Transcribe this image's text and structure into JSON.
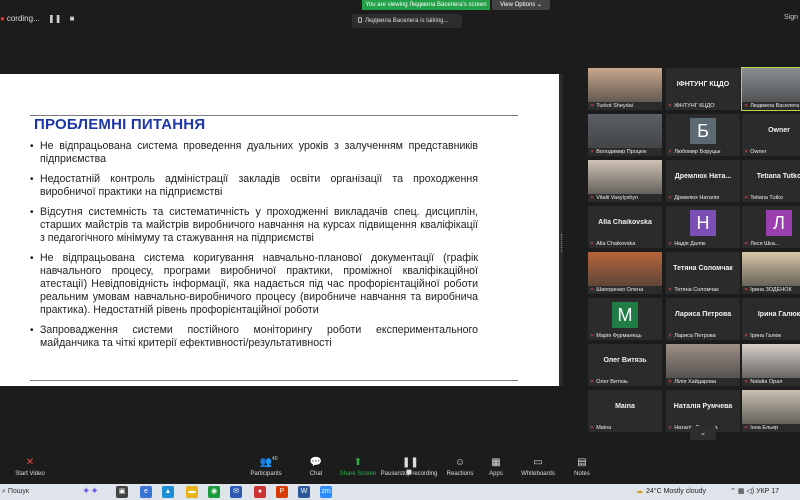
{
  "topbar": {
    "recording": "cording...",
    "recording_dot": "9",
    "viewing_banner": "You are viewing Людмила Васелега's screen",
    "view_options": "View Options",
    "talking": "Людмила Васелега is talking...",
    "sign_in": "Sign"
  },
  "slide": {
    "title": "ПРОБЛЕМНІ ПИТАННЯ",
    "bullets": [
      "Не відпрацьована система проведення дуальних уроків з залученням представників підприємства",
      "Недостатній контроль адміністрації закладів освіти організації та проходження виробничої практики на підприємстві",
      "Відсутня системність та систематичність у проходженні викладачів спец. дисциплін, старших майстрів та майстрів виробничого навчання на курсах підвищення кваліфікації з педагогічного мінімуму та стажування на підприємстві",
      "Не відпрацьована система коригування навчально-планової документації (графік навчального процесу, програми виробничої практики, проміжної кваліфікаційної атестації) Невідповідність інформації, яка надається під час профорієнтаційної роботи реальним умовам навчально-виробничого процесу (виробниче навчання та виробнича практика). Недостатній рівень профорієнтаційної роботи",
      "Запровадження системи постійного моніторингу роботи експериментального майданчика та чіткі критерії ефективності/результативності"
    ]
  },
  "gallery": {
    "tiles": [
      {
        "name": "Turkot Sheydai",
        "big": "",
        "letter": "",
        "color": "#c8a78d"
      },
      {
        "name": "ІФНТУНГ КЦДО",
        "big": "ІФНТУНГ КЦДО",
        "letter": "",
        "color": ""
      },
      {
        "name": "Людмила Васелега",
        "big": "",
        "letter": "",
        "color": "#8a8f93"
      },
      {
        "name": "Володимир Процюк",
        "big": "",
        "letter": "",
        "color": "#5a6066"
      },
      {
        "name": "Любомир Боруцьк",
        "big": "",
        "letter": "Б",
        "color": "#5b6a73"
      },
      {
        "name": "Owner",
        "big": "Owner",
        "letter": "",
        "color": ""
      },
      {
        "name": "Vitalii Vasylyshyn",
        "big": "",
        "letter": "",
        "color": "#cfc2b4"
      },
      {
        "name": "Дремлюх Наталія",
        "big": "Дремлюх  Ната...",
        "letter": "",
        "color": ""
      },
      {
        "name": "Tetiana Tutko",
        "big": "Tetiana Tutko",
        "letter": "",
        "color": ""
      },
      {
        "name": "Alla Chaikovska",
        "big": "Alla Chaikovska",
        "letter": "",
        "color": ""
      },
      {
        "name": "Надія Даляк",
        "big": "",
        "letter": "Н",
        "color": "#7b4fb3"
      },
      {
        "name": "Леся Шка...",
        "big": "",
        "letter": "Л",
        "color": "#9b3fb0"
      },
      {
        "name": "Шапоренко Олена",
        "big": "",
        "letter": "",
        "color": "#b7643a"
      },
      {
        "name": "Тетяна Соломчак",
        "big": "Тетяна Соломчак",
        "letter": "",
        "color": ""
      },
      {
        "name": "Ірина ЗОДЕНОК",
        "big": "",
        "letter": "",
        "color": "#d9c7a8"
      },
      {
        "name": "Марія Фурманець",
        "big": "",
        "letter": "М",
        "color": "#1f7d45"
      },
      {
        "name": "Лариса Петрова",
        "big": "Лариса Петрова",
        "letter": "",
        "color": ""
      },
      {
        "name": "Ірина Галюк",
        "big": "Ірина Галюк",
        "letter": "",
        "color": ""
      },
      {
        "name": "Олег Витязь",
        "big": "Олег Витязь",
        "letter": "",
        "color": ""
      },
      {
        "name": "Лілія Хайдарова",
        "big": "",
        "letter": "",
        "color": "#9d8f86"
      },
      {
        "name": "Natalia Орал",
        "big": "",
        "letter": "",
        "color": "#d8cfc9"
      },
      {
        "name": "Maina",
        "big": "Maina",
        "letter": "",
        "color": ""
      },
      {
        "name": "Наталія Румчева",
        "big": "Наталія Румчева",
        "letter": "",
        "color": ""
      },
      {
        "name": "Інна Ельяр",
        "big": "",
        "letter": "",
        "color": "#c9c0b0"
      }
    ]
  },
  "toolbar": {
    "start_video": "Start Video",
    "participants": "Participants",
    "participants_count": "40",
    "chat": "Chat",
    "share_screen": "Share Screen",
    "pause_recording": "Pause/stop recording",
    "reactions": "Reactions",
    "apps": "Apps",
    "whiteboards": "Whiteboards",
    "notes": "Notes"
  },
  "taskbar": {
    "search": "Пошук",
    "weather": "24°C  Mostly cloudy",
    "lang": "УКР",
    "clock": "17"
  },
  "colors": {
    "accent_green": "#24b24b",
    "slide_title": "#1d36a8"
  }
}
